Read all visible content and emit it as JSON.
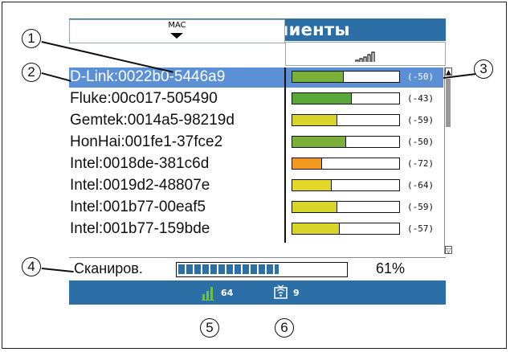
{
  "title": "Тестовые клиенты",
  "columns": {
    "mac_header": "MAC"
  },
  "clients": [
    {
      "mac": "D-Link:0022b0-5446a9",
      "dbm": "(-50)",
      "level": 0.48,
      "color": "#7ab03a",
      "selected": true
    },
    {
      "mac": "Fluke:00c017-505490",
      "dbm": "(-43)",
      "level": 0.56,
      "color": "#5aa83a",
      "selected": false
    },
    {
      "mac": "Gemtek:0014a5-98219d",
      "dbm": "(-59)",
      "level": 0.42,
      "color": "#d9d42a",
      "selected": false
    },
    {
      "mac": "HonHai:001fe1-37fce2",
      "dbm": "(-50)",
      "level": 0.5,
      "color": "#7ab03a",
      "selected": false
    },
    {
      "mac": "Intel:0018de-381c6d",
      "dbm": "(-72)",
      "level": 0.28,
      "color": "#f39a1e",
      "selected": false
    },
    {
      "mac": "Intel:0019d2-48807e",
      "dbm": "(-64)",
      "level": 0.37,
      "color": "#e3d82a",
      "selected": false
    },
    {
      "mac": "Intel:001b77-00eaf5",
      "dbm": "(-59)",
      "level": 0.42,
      "color": "#d9d42a",
      "selected": false
    },
    {
      "mac": "Intel:001b77-159bde",
      "dbm": "(-57)",
      "level": 0.44,
      "color": "#d9d42a",
      "selected": false
    }
  ],
  "scan": {
    "label": "Сканиров.",
    "percent": "61%",
    "progress": 0.61
  },
  "status": {
    "signal_count": "64",
    "clients_count": "9"
  },
  "callouts": [
    "1",
    "2",
    "3",
    "4",
    "5",
    "6"
  ],
  "colors": {
    "accent": "#2c6fa6",
    "selection": "#5b8fd6"
  },
  "icons": [
    "battery-icon",
    "signal-strength-icon",
    "sort-arrow-icon",
    "bars-icon",
    "client-icon"
  ]
}
